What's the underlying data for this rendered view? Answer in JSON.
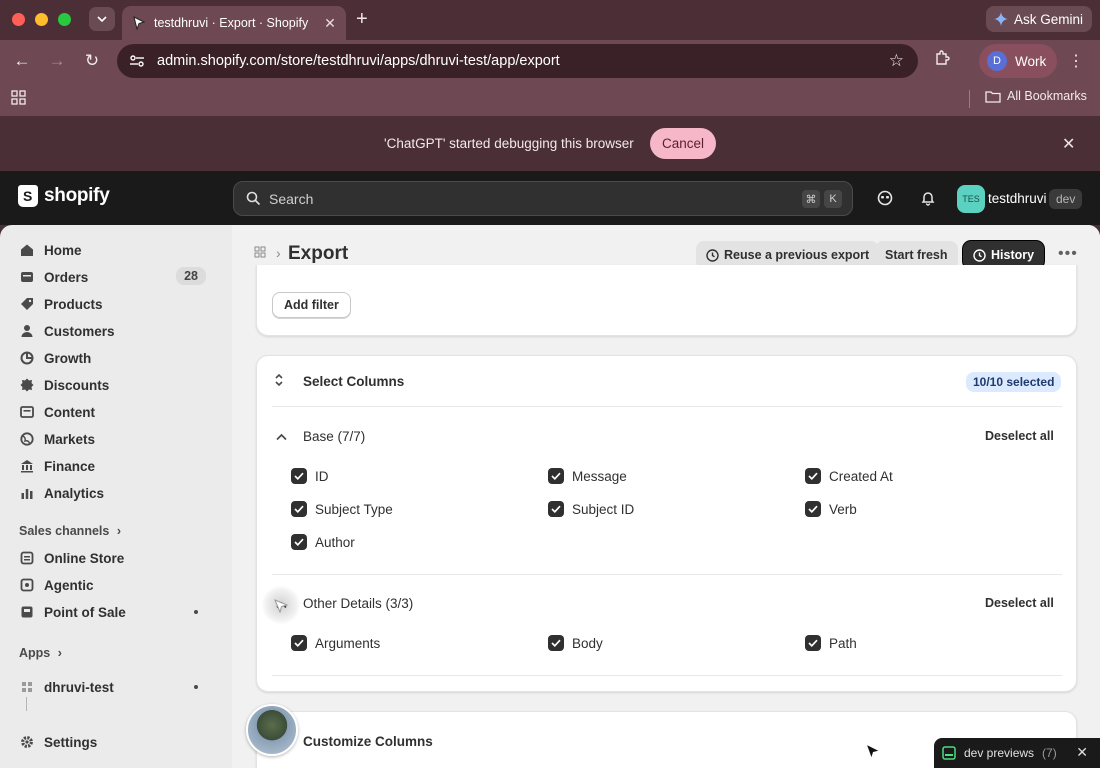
{
  "browser": {
    "tab_title": "testdhruvi · Export · Shopify",
    "new_tab": "+",
    "ask_gemini": "Ask Gemini",
    "url": "admin.shopify.com/store/testdhruvi/apps/dhruvi-test/app/export",
    "profile_initial": "D",
    "profile_label": "Work",
    "all_bookmarks": "All Bookmarks",
    "debug_message": "'ChatGPT' started debugging this browser",
    "debug_cancel": "Cancel"
  },
  "shopify": {
    "logo_text": "shopify",
    "search_placeholder": "Search",
    "shortcut_cmd": "⌘",
    "shortcut_key": "K",
    "store_initials": "TES",
    "store_name": "testdhruvi",
    "store_badge": "dev"
  },
  "sidebar": {
    "items": [
      {
        "label": "Home",
        "icon": "home-icon"
      },
      {
        "label": "Orders",
        "icon": "orders-icon",
        "count": "28"
      },
      {
        "label": "Products",
        "icon": "tag-icon"
      },
      {
        "label": "Customers",
        "icon": "person-icon"
      },
      {
        "label": "Growth",
        "icon": "growth-icon"
      },
      {
        "label": "Discounts",
        "icon": "discount-icon"
      },
      {
        "label": "Content",
        "icon": "content-icon"
      },
      {
        "label": "Markets",
        "icon": "globe-icon"
      },
      {
        "label": "Finance",
        "icon": "bank-icon"
      },
      {
        "label": "Analytics",
        "icon": "chart-icon"
      }
    ],
    "sales_channels_label": "Sales channels",
    "channels": [
      {
        "label": "Online Store",
        "icon": "store-icon"
      },
      {
        "label": "Agentic",
        "icon": "agentic-icon"
      },
      {
        "label": "Point of Sale",
        "icon": "pos-icon"
      }
    ],
    "apps_label": "Apps",
    "apps": [
      {
        "label": "dhruvi-test",
        "icon": "app-icon"
      }
    ],
    "settings_label": "Settings"
  },
  "page": {
    "title": "Export",
    "reuse_label": "Reuse a previous export",
    "start_fresh_label": "Start fresh",
    "history_label": "History",
    "add_filter_label": "Add filter",
    "select_columns": {
      "title": "Select Columns",
      "badge": "10/10 selected",
      "groups": [
        {
          "title": "Base (7/7)",
          "deselect": "Deselect all",
          "columns": [
            "ID",
            "Message",
            "Created At",
            "Subject Type",
            "Subject ID",
            "Verb",
            "Author"
          ]
        },
        {
          "title": "Other Details (3/3)",
          "deselect": "Deselect all",
          "columns": [
            "Arguments",
            "Body",
            "Path"
          ]
        }
      ]
    },
    "customize_columns_title": "Customize Columns"
  },
  "dev_previews": {
    "label": "dev previews",
    "count": "(7)"
  },
  "colors": {
    "browser_frame": "#6e4852",
    "shopify_bar": "#1a1a1a",
    "sidebar_bg": "#ebebeb",
    "main_bg": "#f1f1f1",
    "cancel_pill": "#f6b8c9",
    "badge_blue": "#dbeafe",
    "store_avatar": "#5bd2c1"
  }
}
